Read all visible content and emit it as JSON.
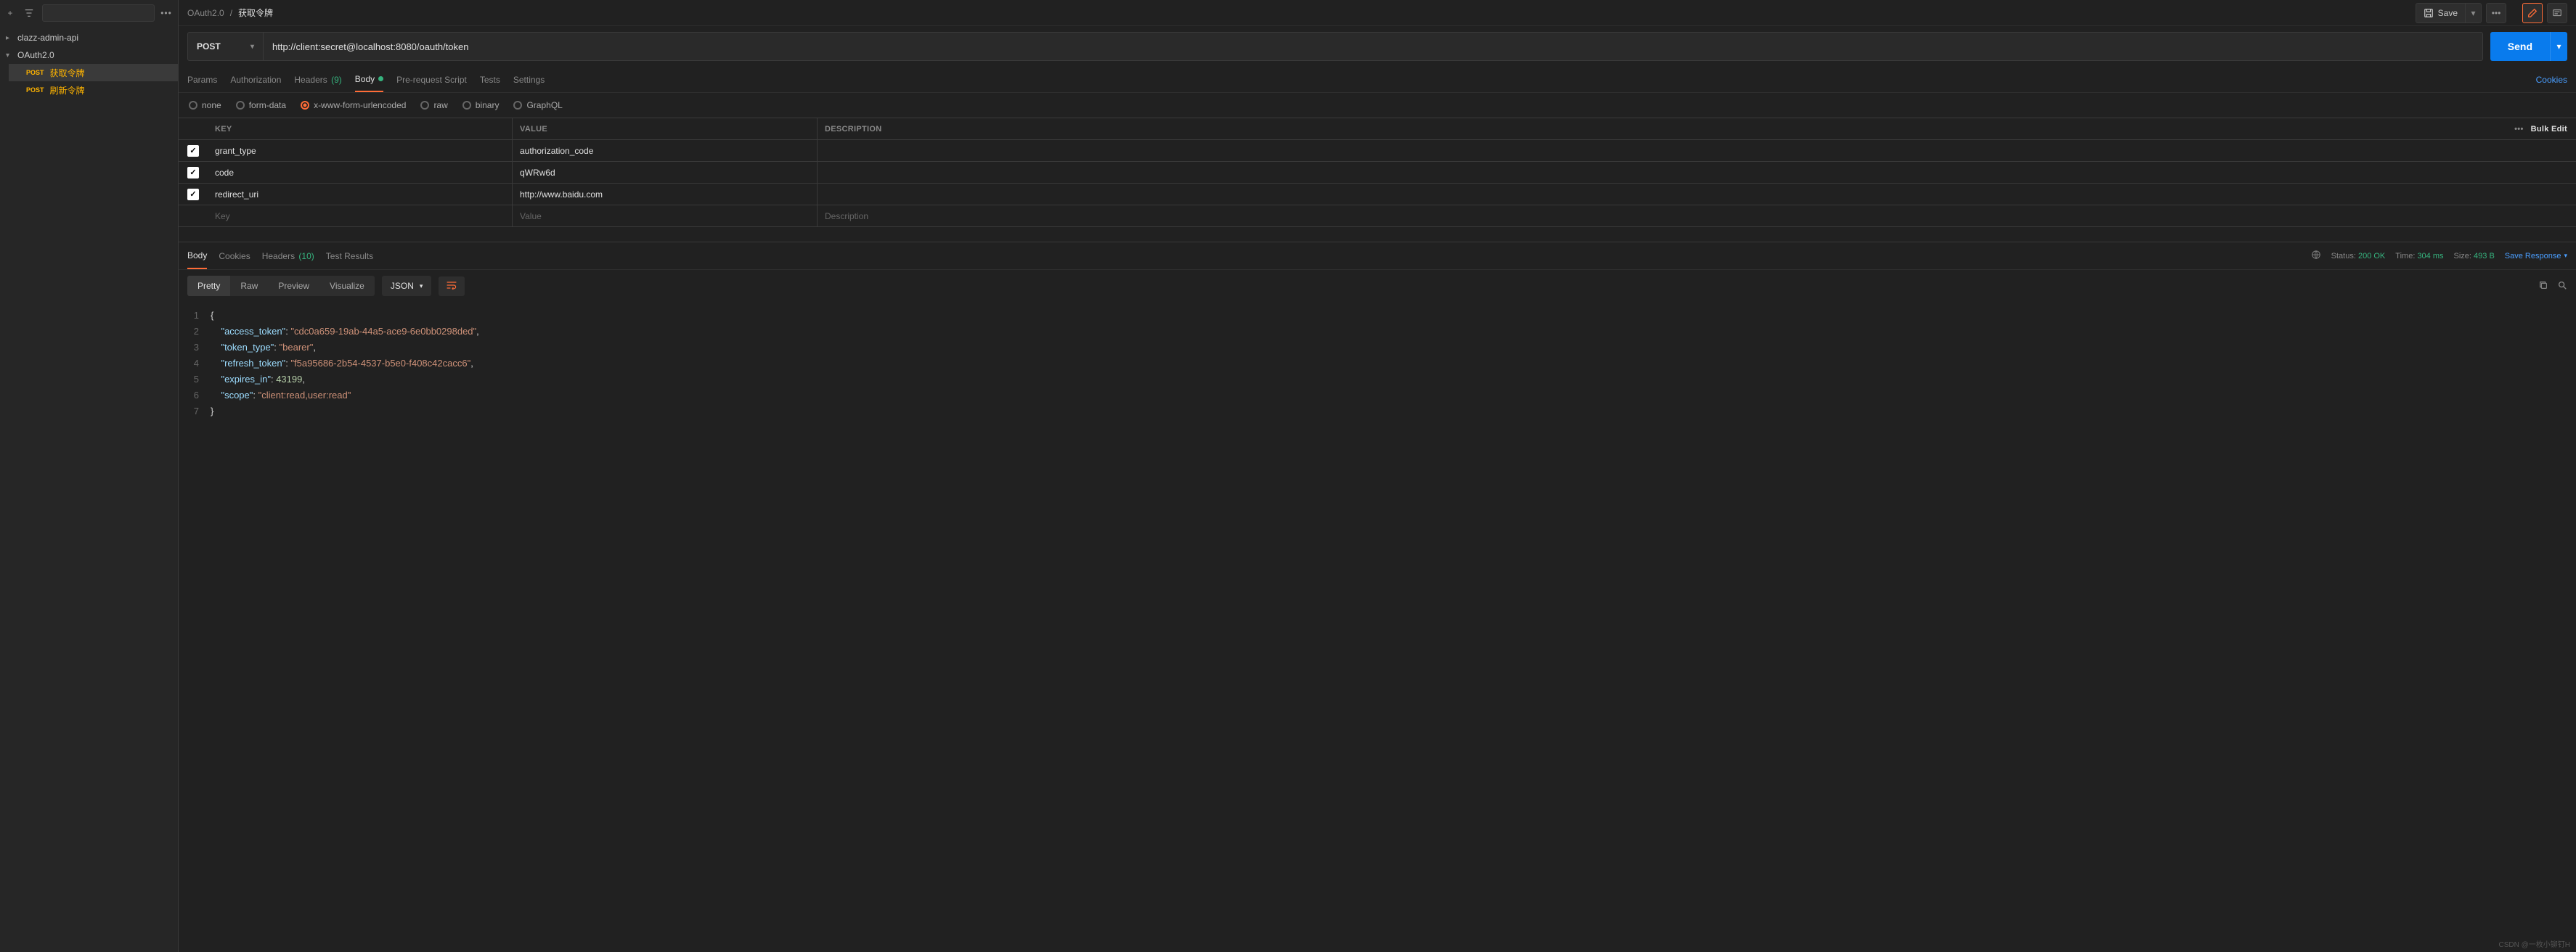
{
  "sidebar": {
    "collections": [
      {
        "name": "clazz-admin-api",
        "expanded": false
      },
      {
        "name": "OAuth2.0",
        "expanded": true
      }
    ],
    "requests": [
      {
        "method": "POST",
        "label": "获取令牌",
        "active": true
      },
      {
        "method": "POST",
        "label": "刷新令牌",
        "active": false
      }
    ]
  },
  "breadcrumb": {
    "parent": "OAuth2.0",
    "current": "获取令牌"
  },
  "topbar": {
    "save_label": "Save"
  },
  "request": {
    "method": "POST",
    "url": "http://client:secret@localhost:8080/oauth/token",
    "send_label": "Send"
  },
  "req_tabs": {
    "params": "Params",
    "authorization": "Authorization",
    "headers": "Headers",
    "headers_count": "(9)",
    "body": "Body",
    "prerequest": "Pre-request Script",
    "tests": "Tests",
    "settings": "Settings",
    "cookies": "Cookies"
  },
  "body_types": {
    "none": "none",
    "formdata": "form-data",
    "urlencoded": "x-www-form-urlencoded",
    "raw": "raw",
    "binary": "binary",
    "graphql": "GraphQL"
  },
  "params_table": {
    "headers": {
      "key": "KEY",
      "value": "VALUE",
      "description": "DESCRIPTION"
    },
    "bulk_edit": "Bulk Edit",
    "rows": [
      {
        "key": "grant_type",
        "value": "authorization_code",
        "desc": ""
      },
      {
        "key": "code",
        "value": "qWRw6d",
        "desc": ""
      },
      {
        "key": "redirect_uri",
        "value": "http://www.baidu.com",
        "desc": ""
      }
    ],
    "placeholders": {
      "key": "Key",
      "value": "Value",
      "desc": "Description"
    }
  },
  "response": {
    "tabs": {
      "body": "Body",
      "cookies": "Cookies",
      "headers": "Headers",
      "headers_count": "(10)",
      "test_results": "Test Results"
    },
    "status_label": "Status:",
    "status_value": "200 OK",
    "time_label": "Time:",
    "time_value": "304 ms",
    "size_label": "Size:",
    "size_value": "493 B",
    "save_response": "Save Response",
    "views": {
      "pretty": "Pretty",
      "raw": "Raw",
      "preview": "Preview",
      "visualize": "Visualize"
    },
    "format": "JSON",
    "body_json": {
      "access_token": "cdc0a659-19ab-44a5-ace9-6e0bb0298ded",
      "token_type": "bearer",
      "refresh_token": "f5a95686-2b54-4537-b5e0-f408c42cacc6",
      "expires_in": 43199,
      "scope": "client:read,user:read"
    }
  },
  "watermark": "CSDN @一枚小铆钉H"
}
